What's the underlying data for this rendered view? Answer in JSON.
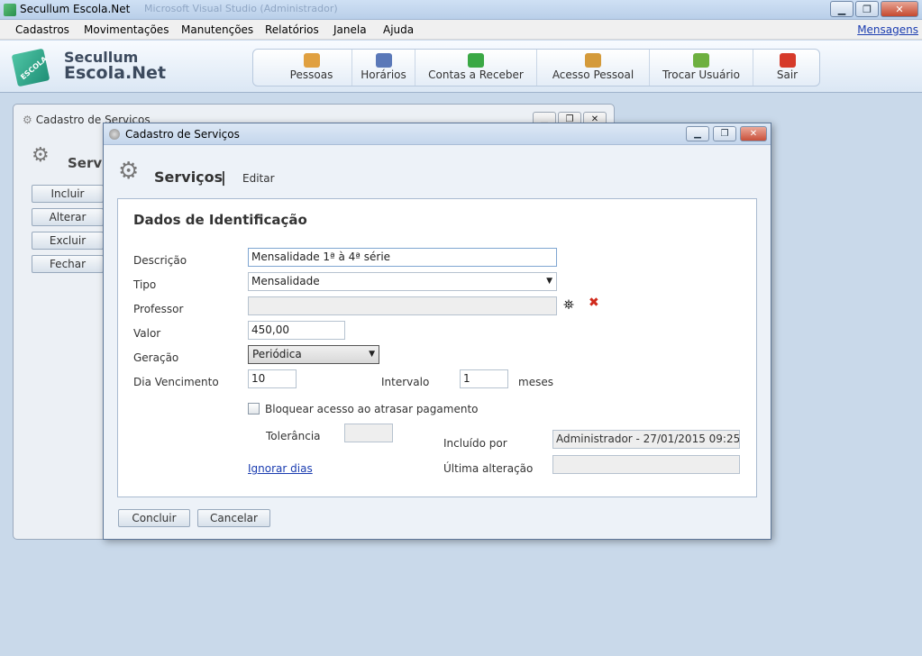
{
  "app": {
    "title": "Secullum Escola.Net",
    "ghost_title": "Microsoft Visual Studio (Administrador)"
  },
  "menu": {
    "items": [
      "Cadastros",
      "Movimentações",
      "Manutenções",
      "Relatórios",
      "Janela",
      "Ajuda"
    ],
    "messages": "Mensagens"
  },
  "brand": {
    "line1": "Secullum",
    "line2": "Escola.Net",
    "cube_text": "ESCOLA"
  },
  "toolbar": {
    "buttons": [
      {
        "label": "Pessoas",
        "icon": "people-icon",
        "color": "#e0a040"
      },
      {
        "label": "Horários",
        "icon": "calendar-icon",
        "color": "#5a78b8"
      },
      {
        "label": "Contas a Receber",
        "icon": "receivable-icon",
        "color": "#3aa845"
      },
      {
        "label": "Acesso Pessoal",
        "icon": "access-icon",
        "color": "#d49a3a"
      },
      {
        "label": "Trocar Usuário",
        "icon": "switch-user-icon",
        "color": "#6db03f"
      },
      {
        "label": "Sair",
        "icon": "power-icon",
        "color": "#d63a2a"
      }
    ]
  },
  "bg_window": {
    "title": "Cadastro de Serviços",
    "heading": "Servi",
    "buttons": [
      "Incluir",
      "Alterar",
      "Excluir",
      "Fechar"
    ]
  },
  "dialog": {
    "title": "Cadastro de Serviços",
    "header": "Serviços",
    "separator": "|",
    "mode": "Editar",
    "section_title": "Dados de Identificação",
    "labels": {
      "descricao": "Descrição",
      "tipo": "Tipo",
      "professor": "Professor",
      "valor": "Valor",
      "geracao": "Geração",
      "dia_vencimento": "Dia Vencimento",
      "intervalo": "Intervalo",
      "meses": "meses",
      "bloquear": "Bloquear acesso ao atrasar pagamento",
      "tolerancia": "Tolerância",
      "incluido_por": "Incluído por",
      "ultima_alteracao": "Última alteração",
      "ignorar_dias": "Ignorar dias"
    },
    "values": {
      "descricao": "Mensalidade 1ª à 4ª série",
      "tipo": "Mensalidade",
      "professor": "",
      "valor": "450,00",
      "geracao": "Periódica",
      "dia_vencimento": "10",
      "intervalo": "1",
      "tolerancia": "",
      "incluido_por": "Administrador - 27/01/2015 09:25:",
      "ultima_alteracao": ""
    },
    "bloquear_checked": false,
    "buttons": {
      "concluir": "Concluir",
      "cancelar": "Cancelar"
    }
  },
  "window_controls": {
    "minimize": "▁",
    "restore": "❐",
    "close": "✕"
  }
}
